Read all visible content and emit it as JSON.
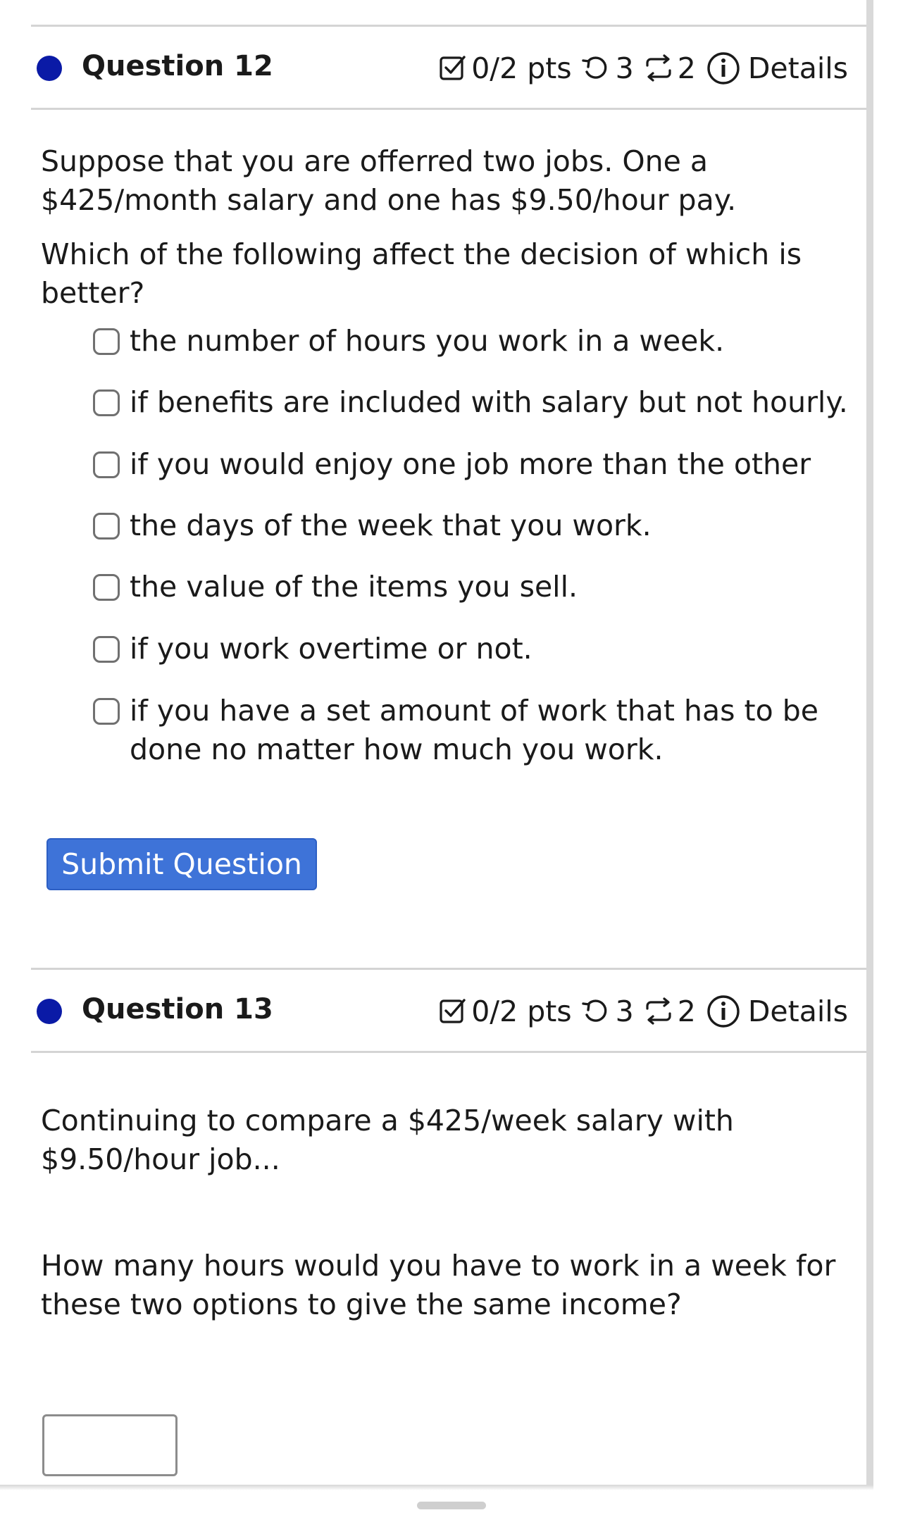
{
  "questions": [
    {
      "title": "Question 12",
      "points": "0/2 pts",
      "retries": "3",
      "versions": "2",
      "details_label": "Details",
      "text": [
        "Suppose that you are offerred two jobs. One a $425/month salary and one has $9.50/hour pay.",
        "Which of the following affect the decision of which is better?"
      ],
      "options": [
        "the number of hours you work in a week.",
        "if benefits are included with salary but not hourly.",
        "if you would enjoy one job more than the other",
        "the days of the week that you work.",
        "the value of the items you sell.",
        "if you work overtime or not.",
        "if you have a set amount of work that has to be done no matter how much you work."
      ],
      "submit_label": "Submit Question"
    },
    {
      "title": "Question 13",
      "points": "0/2 pts",
      "retries": "3",
      "versions": "2",
      "details_label": "Details",
      "text": [
        "Continuing to compare a $425/week salary with $9.50/hour job...",
        "How many hours would you have to work in a week for these two options to give the same income?"
      ],
      "answer_value": ""
    }
  ],
  "colors": {
    "question_dot": "#0a1aa6",
    "submit_button": "#3e73d8",
    "divider": "#d4d4d4"
  },
  "icons": [
    "checkbox-check-icon",
    "retry-icon",
    "versions-icon",
    "info-icon"
  ]
}
